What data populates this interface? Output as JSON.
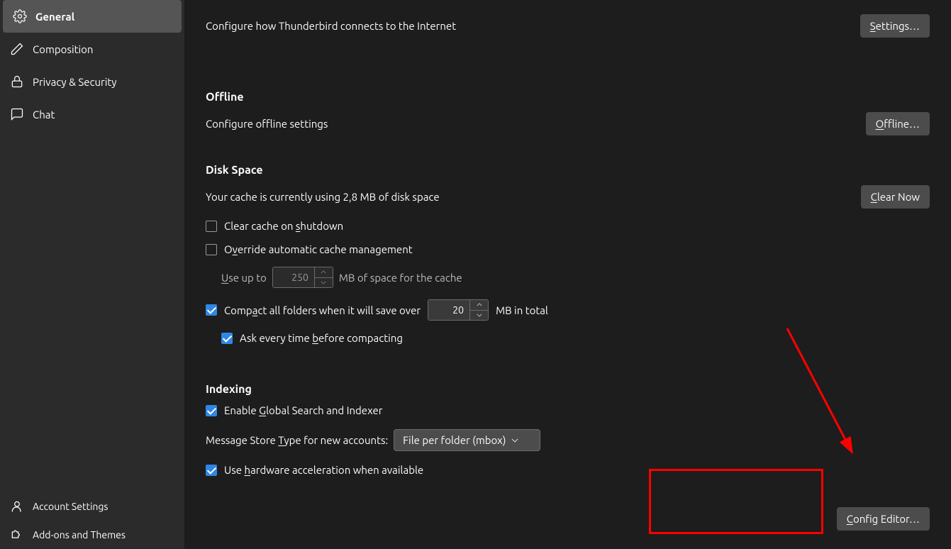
{
  "sidebar": {
    "items": [
      {
        "label": "General"
      },
      {
        "label": "Composition"
      },
      {
        "label": "Privacy & Security"
      },
      {
        "label": "Chat"
      }
    ],
    "bottom": [
      {
        "label": "Account Settings"
      },
      {
        "label": "Add-ons and Themes"
      }
    ]
  },
  "net": {
    "desc": "Configure how Thunderbird connects to the Internet",
    "btn_u": "S",
    "btn_rest": "ettings…"
  },
  "offline": {
    "heading": "Offline",
    "desc": "Configure offline settings",
    "btn_u": "O",
    "btn_rest": "ffline…"
  },
  "disk": {
    "heading": "Disk Space",
    "cache_desc": "Your cache is currently using 2,8 MB of disk space",
    "clear_u": "C",
    "clear_rest": "lear Now",
    "cb_clear_pre": "Clear cache on ",
    "cb_clear_u": "s",
    "cb_clear_post": "hutdown",
    "cb_override_pre": "O",
    "cb_override_u": "v",
    "cb_override_post": "erride automatic cache management",
    "use_pre": "",
    "use_u": "U",
    "use_mid": "se up to",
    "cache_value": "250",
    "use_post": "MB of space for the cache",
    "compact_pre": "Comp",
    "compact_u": "a",
    "compact_mid": "ct all folders when it will save over",
    "compact_value": "20",
    "compact_post": "MB in total",
    "ask_pre": "Ask every time ",
    "ask_u": "b",
    "ask_post": "efore compacting"
  },
  "indexing": {
    "heading": "Indexing",
    "cb_global_pre": "Enable ",
    "cb_global_u": "G",
    "cb_global_post": "lobal Search and Indexer",
    "store_pre": "Message Store ",
    "store_u": "T",
    "store_post": "ype for new accounts:",
    "store_value": "File per folder (mbox)",
    "cb_hw_pre": "Use ",
    "cb_hw_u": "h",
    "cb_hw_post": "ardware acceleration when available"
  },
  "config": {
    "btn_u": "C",
    "btn_rest": "onfig Editor…"
  }
}
